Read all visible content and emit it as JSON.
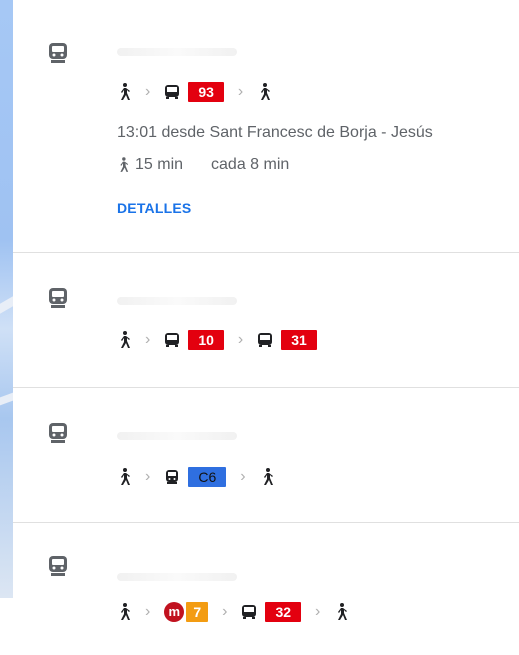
{
  "routes": [
    {
      "first_badge": "93",
      "first_badge_color": "#e3000f",
      "departure": "13:01 desde Sant Francesc de Borja - Jesús",
      "walk_time": "15 min",
      "frequency": "cada 8 min",
      "details_label": "DETALLES"
    },
    {
      "badge_a": "10",
      "badge_b": "31",
      "badge_color": "#e3000f"
    },
    {
      "badge": "C6",
      "badge_color": "#2f6fe0"
    },
    {
      "metro_letter": "m",
      "metro_line": "7",
      "metro_line_color": "#f39c12",
      "bus_badge": "32",
      "bus_color": "#e3000f"
    }
  ],
  "icons": {
    "tram": "tram-icon",
    "walk": "walk-icon",
    "bus": "bus-icon",
    "chevron": "chevron-right-icon"
  },
  "colors": {
    "link": "#1a73e8",
    "red_line": "#e3000f",
    "blue_line": "#2f6fe0",
    "orange_line": "#f39c12"
  }
}
